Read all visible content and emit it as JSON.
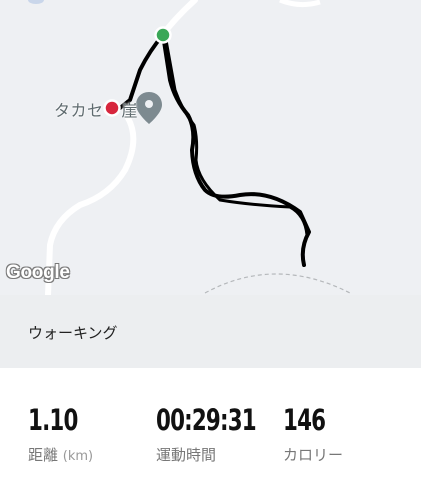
{
  "map": {
    "place_label": "タカセ",
    "place_label_suffix": "崖",
    "attribution": "Google"
  },
  "activity": {
    "type_label": "ウォーキング"
  },
  "stats": {
    "distance": {
      "value": "1.10",
      "label": "距離",
      "unit": "(km)"
    },
    "duration": {
      "value": "00:29:31",
      "label": "運動時間"
    },
    "calories": {
      "value": "146",
      "label": "カロリー"
    }
  },
  "colors": {
    "start_marker": "#3aa757",
    "end_marker": "#d7263d",
    "route": "#000000",
    "road": "#ffffff",
    "map_bg": "#eef0f3"
  }
}
